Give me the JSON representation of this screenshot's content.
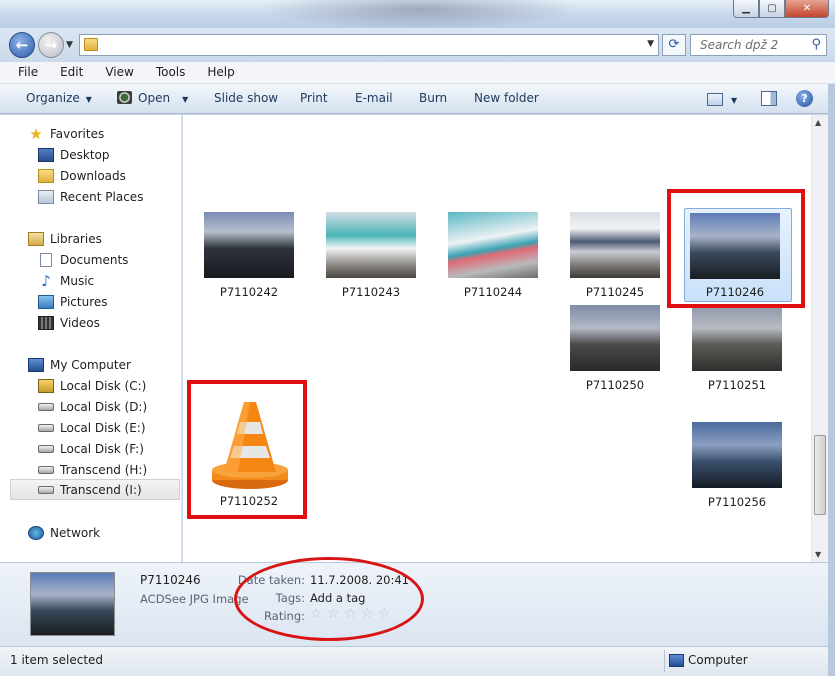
{
  "window": {
    "search_placeholder": "Search dpž 2",
    "minimize_icon": "minimize-icon",
    "maximize_icon": "maximize-icon",
    "close_icon": "close-icon"
  },
  "menu": [
    "File",
    "Edit",
    "View",
    "Tools",
    "Help"
  ],
  "toolbar": {
    "organize": "Organize",
    "open": "Open",
    "slideshow": "Slide show",
    "print": "Print",
    "email": "E-mail",
    "burn": "Burn",
    "new_folder": "New folder"
  },
  "nav": {
    "favorites": "Favorites",
    "desktop": "Desktop",
    "downloads": "Downloads",
    "recent": "Recent Places",
    "libraries": "Libraries",
    "documents": "Documents",
    "music": "Music",
    "pictures": "Pictures",
    "videos": "Videos",
    "computer": "My Computer",
    "disk_c": "Local Disk (C:)",
    "disk_d": "Local Disk (D:)",
    "disk_e": "Local Disk (E:)",
    "disk_f": "Local Disk (F:)",
    "transcend_h": "Transcend  (H:)",
    "transcend_i": "Transcend (I:)",
    "network": "Network"
  },
  "files": {
    "f242": "P7110242",
    "f243": "P7110243",
    "f244": "P7110244",
    "f245": "P7110245",
    "f246": "P7110246",
    "f250": "P7110250",
    "f251": "P7110251",
    "f252": "P7110252",
    "f256": "P7110256"
  },
  "details": {
    "name": "P7110246",
    "type": "ACDSee JPG Image",
    "date_label": "Date taken:",
    "date_value": "11.7.2008. 20:41",
    "tags_label": "Tags:",
    "tags_value": "Add a tag",
    "rating_label": "Rating:",
    "rating_stars": 0
  },
  "status": {
    "selection": "1 item selected",
    "location": "Computer"
  },
  "colors": {
    "annotation_red": "#e01010",
    "selection_blue": "#c9e1fa"
  }
}
